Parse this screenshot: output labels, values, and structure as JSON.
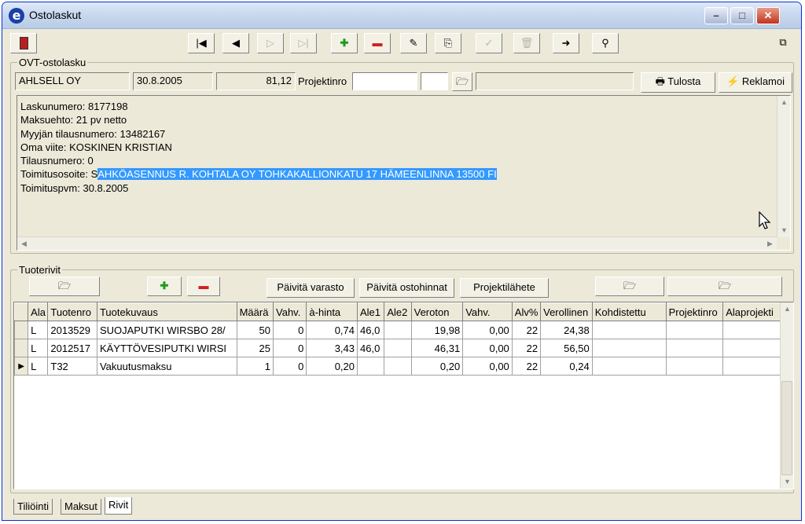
{
  "window": {
    "title": "Ostolaskut",
    "app_icon": "e"
  },
  "header": {
    "group_label": "OVT-ostolasku",
    "supplier": "AHLSELL OY",
    "date": "30.8.2005",
    "amount": "81,12",
    "projektinro_label": "Projektinro",
    "print_label": "Tulosta",
    "complain_label": "Reklamoi"
  },
  "memo": {
    "lines": [
      "Laskunumero: 8177198",
      "Maksuehto: 21 pv netto",
      "Myyjän tilausnumero: 13482167",
      "Oma viite: KOSKINEN KRISTIAN",
      "Tilausnumero: 0"
    ],
    "address_prefix": "Toimitusosoite: S",
    "address_highlight": "AHKÖASENNUS R. KOHTALA OY TOHKAKALLIONKATU 17 HÄMEENLINNA 13500 FI",
    "delivery_date": "Toimituspvm: 30.8.2005"
  },
  "products": {
    "group_label": "Tuoterivit",
    "update_stock_label": "Päivitä varasto",
    "update_prices_label": "Päivitä ostohinnat",
    "project_send_label": "Projektilähete",
    "columns": [
      "Ala",
      "Tuotenro",
      "Tuotekuvaus",
      "Määrä",
      "Vahv.",
      "à-hinta",
      "Ale1",
      "Ale2",
      "Veroton",
      "Vahv.",
      "Alv%",
      "Verollinen",
      "Kohdistettu",
      "Projektinro",
      "Alaprojekti"
    ],
    "rows": [
      [
        "L",
        "2013529",
        "SUOJAPUTKI WIRSBO 28/",
        "50",
        "0",
        "0,74",
        "46,0",
        "",
        "19,98",
        "0,00",
        "22",
        "24,38",
        "",
        "",
        ""
      ],
      [
        "L",
        "2012517",
        "KÄYTTÖVESIPUTKI WIRSI",
        "25",
        "0",
        "3,43",
        "46,0",
        "",
        "46,31",
        "0,00",
        "22",
        "56,50",
        "",
        "",
        ""
      ],
      [
        "L",
        "T32",
        "Vakuutusmaksu",
        "1",
        "0",
        "0,20",
        "",
        "",
        "0,20",
        "0,00",
        "22",
        "0,24",
        "",
        "",
        ""
      ]
    ]
  },
  "tabs": [
    "Tiliöinti",
    "Maksut",
    "Rivit"
  ],
  "colors": {
    "selection": "#3399ff",
    "window_bg": "#ece9d8",
    "title_bar": "#c9d9ef"
  }
}
